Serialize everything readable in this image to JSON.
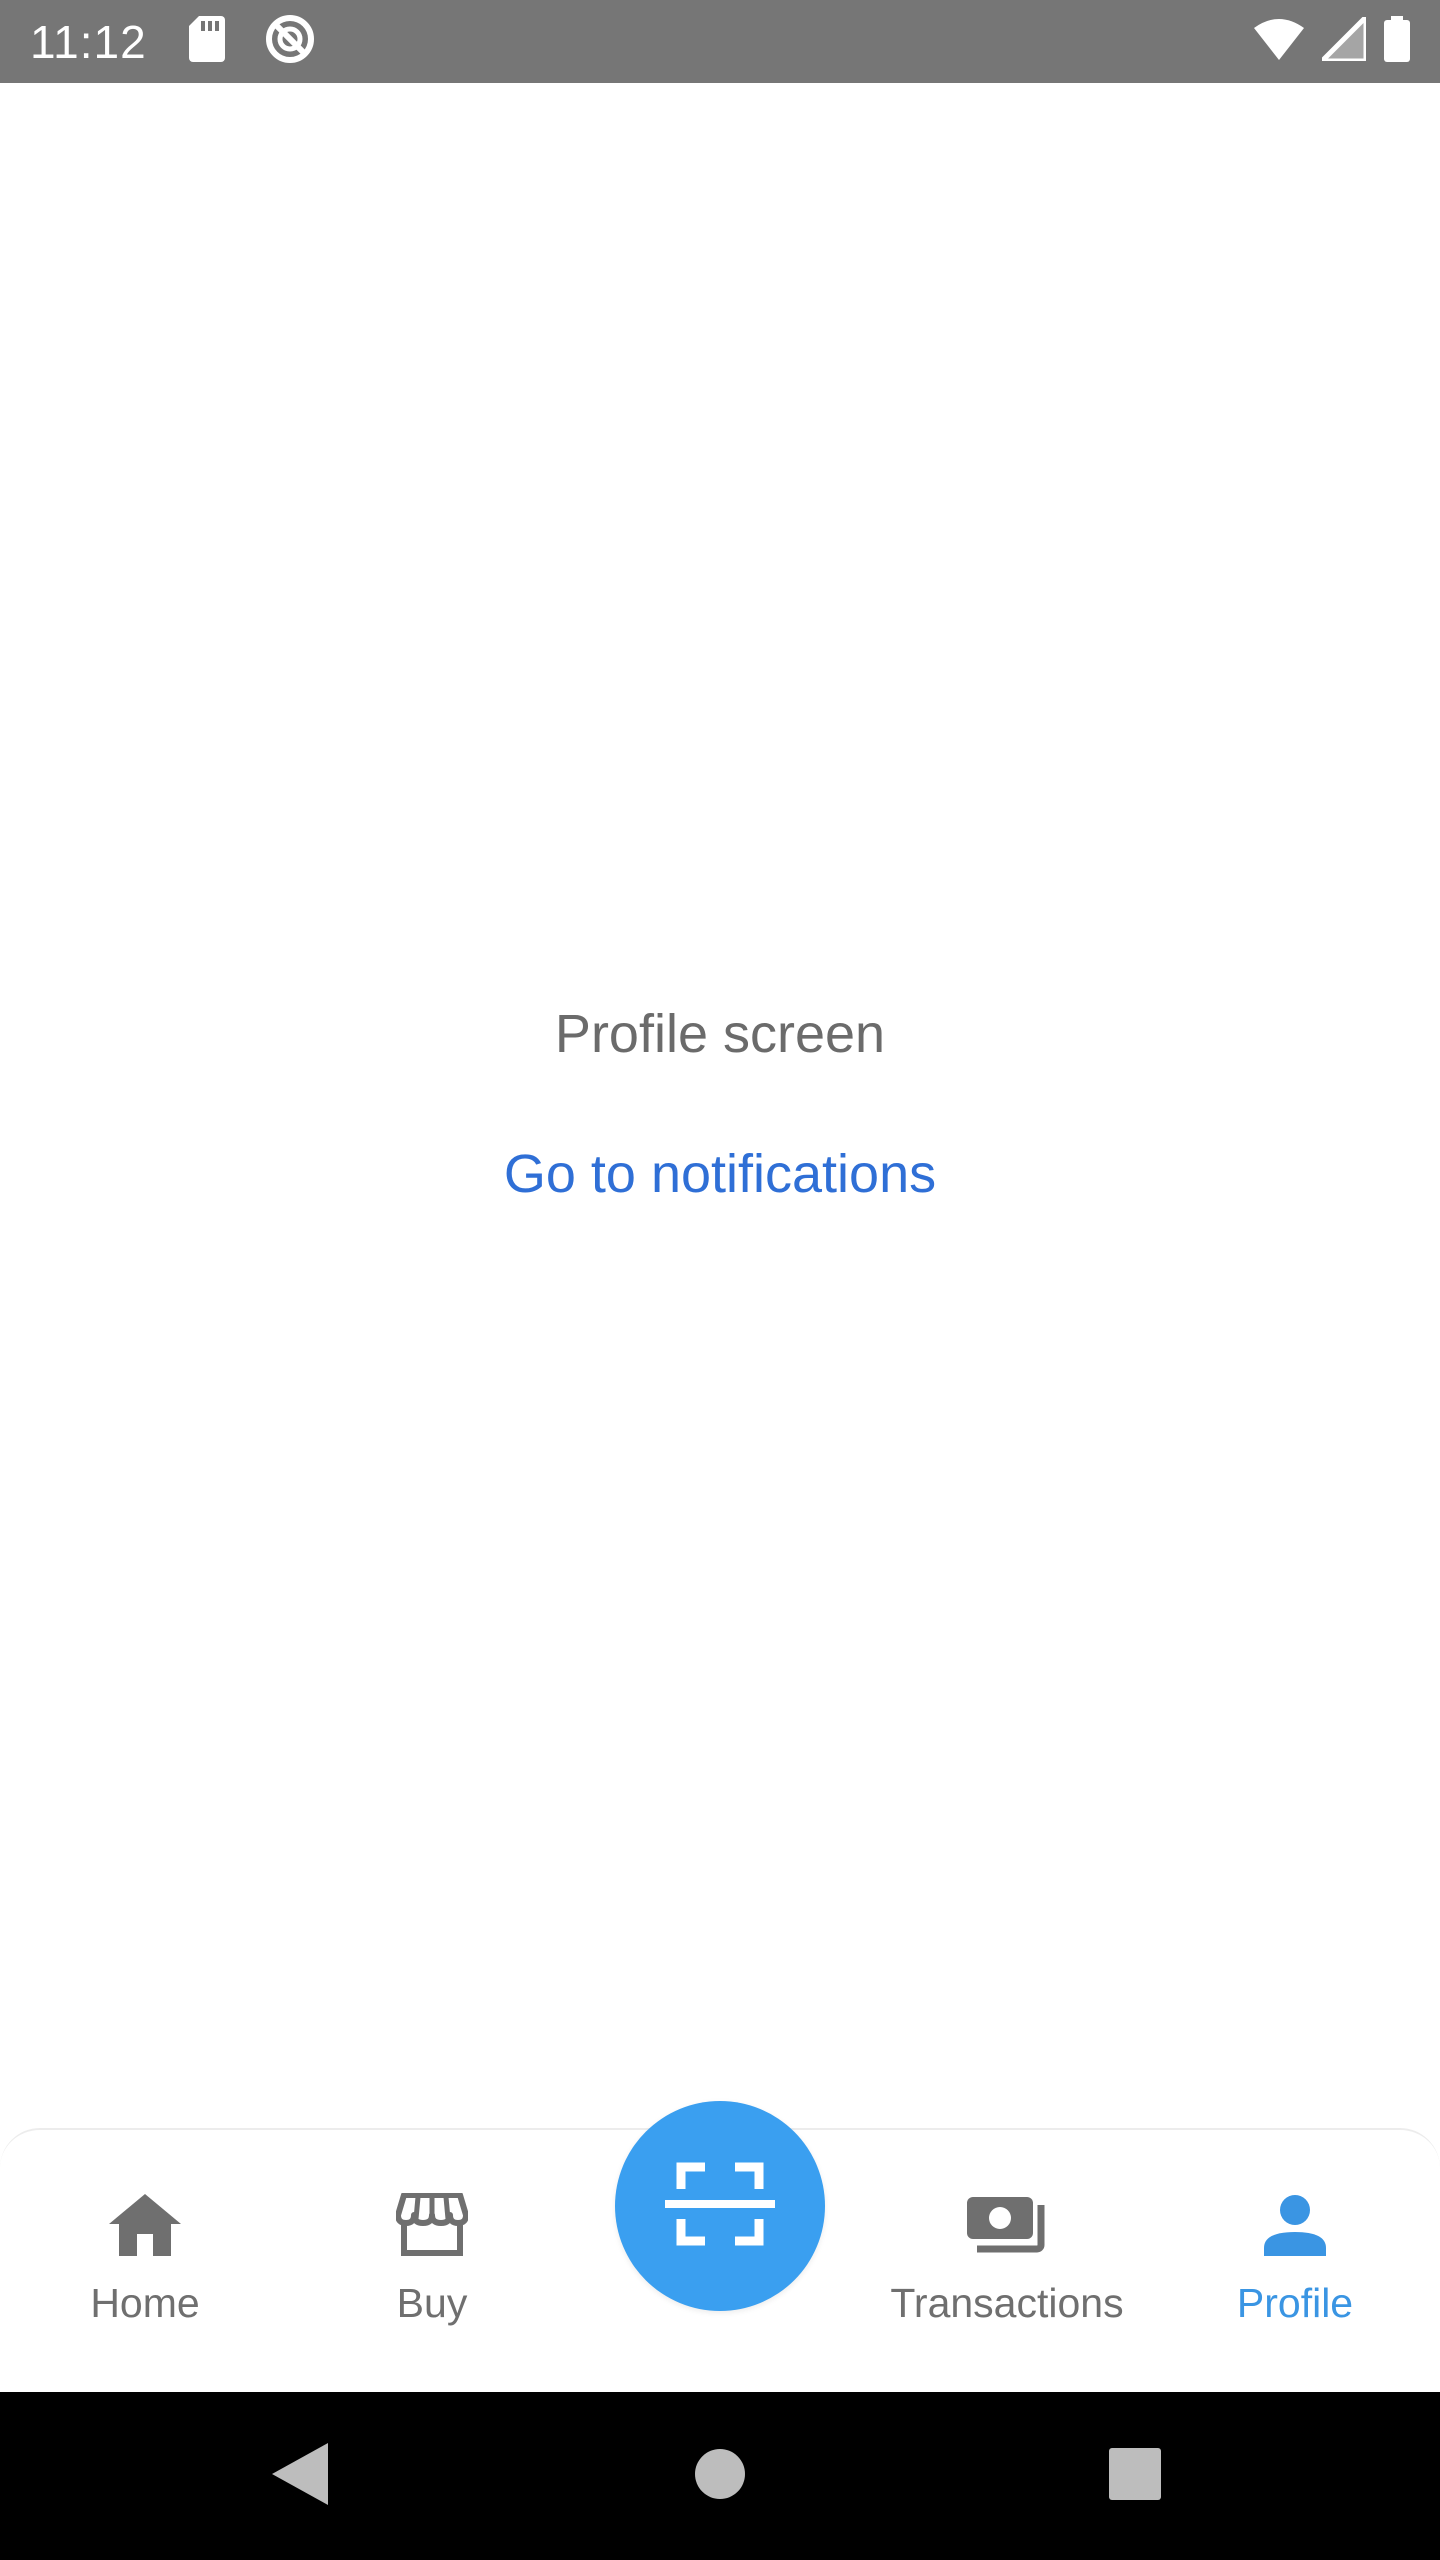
{
  "status_bar": {
    "time": "11:12",
    "icons": [
      "sd-card-icon",
      "sync-icon",
      "wifi-icon",
      "signal-icon",
      "battery-icon"
    ]
  },
  "main": {
    "title": "Profile screen",
    "link": "Go to notifications"
  },
  "tabbar": {
    "tabs": [
      {
        "label": "Home",
        "icon": "home-icon",
        "active": false
      },
      {
        "label": "Buy",
        "icon": "store-icon",
        "active": false
      },
      {
        "label": "Transactions",
        "icon": "money-icon",
        "active": false
      },
      {
        "label": "Profile",
        "icon": "person-icon",
        "active": true
      }
    ],
    "center_action_icon": "scan-icon"
  },
  "colors": {
    "accent": "#3a9ff0",
    "active_tab": "#3a95e3",
    "link": "#2f6fd6",
    "status_bar": "#767676"
  }
}
